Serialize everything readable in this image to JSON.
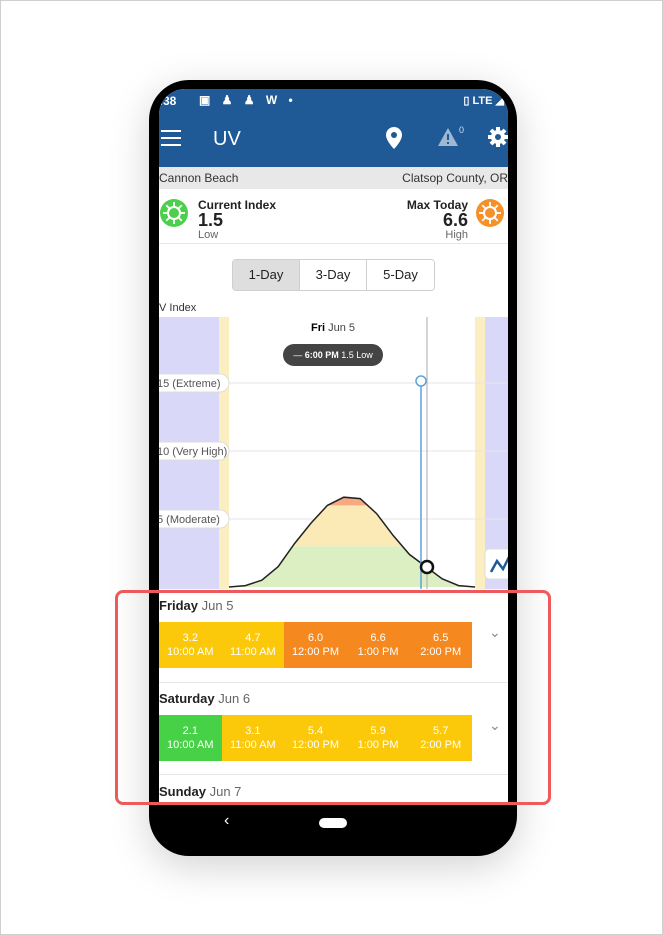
{
  "statusbar": {
    "time": ":38",
    "notifications": "▣ ♟ ♟ W •",
    "right": "▯ LTE ◢"
  },
  "appbar": {
    "title": "UV",
    "alert_count": "0"
  },
  "location": {
    "city": "Cannon Beach",
    "county": "Clatsop County, OR"
  },
  "current": {
    "label": "Current Index",
    "value": "1.5",
    "description": "Low"
  },
  "max": {
    "label": "Max Today",
    "value": "6.6",
    "description": "High"
  },
  "range_tabs": [
    "1-Day",
    "3-Day",
    "5-Day"
  ],
  "active_tab": "1-Day",
  "chart_data": {
    "type": "area",
    "ylabel": "V Index",
    "day_label": "Fri",
    "day_date": "Jun 5",
    "levels": [
      {
        "value": 15,
        "label": "15 (Extreme)"
      },
      {
        "value": 10,
        "label": "10 (Very High)"
      },
      {
        "value": 5,
        "label": "5 (Moderate)"
      }
    ],
    "tooltip": {
      "time": "6:00 PM",
      "value": "1.5 Low"
    },
    "series": [
      {
        "values": [
          0,
          0.1,
          0.5,
          1.5,
          3.2,
          4.7,
          6.0,
          6.6,
          6.5,
          5.4,
          3.8,
          2.4,
          1.5,
          0.6,
          0.1,
          0
        ]
      }
    ],
    "colors": {
      "night": "#d9d8f8",
      "dawn": "#fbeec0",
      "low": "#dcefc3",
      "moderate": "#fbe9b6",
      "high": "#f7a981",
      "line": "#222222",
      "cursor": "#5ba4e0"
    }
  },
  "forecast": [
    {
      "day": "Friday",
      "date": "Jun 5",
      "hours": [
        {
          "value": "3.2",
          "time": "10:00 AM",
          "color": "#fcc80a"
        },
        {
          "value": "4.7",
          "time": "11:00 AM",
          "color": "#fcc80a"
        },
        {
          "value": "6.0",
          "time": "12:00 PM",
          "color": "#f5891f"
        },
        {
          "value": "6.6",
          "time": "1:00 PM",
          "color": "#f5891f"
        },
        {
          "value": "6.5",
          "time": "2:00 PM",
          "color": "#f5891f"
        }
      ]
    },
    {
      "day": "Saturday",
      "date": "Jun 6",
      "hours": [
        {
          "value": "2.1",
          "time": "10:00 AM",
          "color": "#47d147"
        },
        {
          "value": "3.1",
          "time": "11:00 AM",
          "color": "#fcc80a"
        },
        {
          "value": "5.4",
          "time": "12:00 PM",
          "color": "#fcc80a"
        },
        {
          "value": "5.9",
          "time": "1:00 PM",
          "color": "#fcc80a"
        },
        {
          "value": "5.7",
          "time": "2:00 PM",
          "color": "#fcc80a"
        }
      ]
    },
    {
      "day": "Sunday",
      "date": "Jun 7",
      "hours": []
    }
  ],
  "navbar": {
    "back": "‹"
  }
}
